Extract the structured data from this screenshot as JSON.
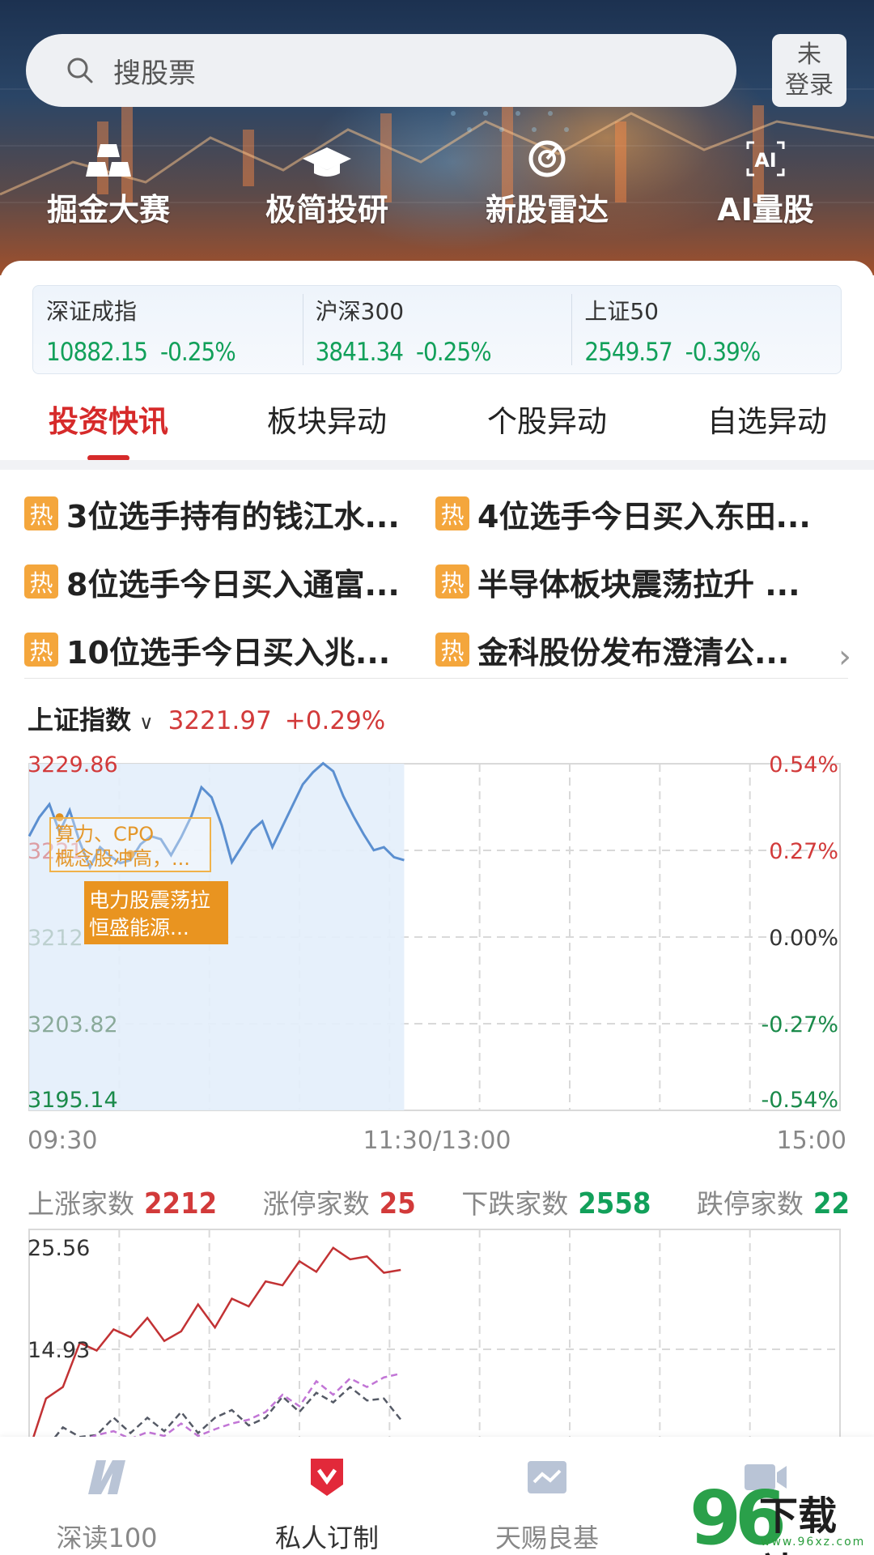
{
  "search": {
    "placeholder": "搜股票"
  },
  "login": {
    "line1": "未",
    "line2": "登录"
  },
  "quick_entries": [
    {
      "label": "掘金大赛",
      "icon": "gold-bars-icon"
    },
    {
      "label": "极简投研",
      "icon": "graduation-cap-icon"
    },
    {
      "label": "新股雷达",
      "icon": "radar-icon"
    },
    {
      "label": "AI量股",
      "icon": "ai-icon"
    }
  ],
  "indexes": [
    {
      "name": "深证成指",
      "value": "10882.15",
      "change": "-0.25%"
    },
    {
      "name": "沪深300",
      "value": "3841.34",
      "change": "-0.25%"
    },
    {
      "name": "上证50",
      "value": "2549.57",
      "change": "-0.39%"
    }
  ],
  "tabs": [
    {
      "label": "投资快讯",
      "active": true
    },
    {
      "label": "板块异动",
      "active": false
    },
    {
      "label": "个股异动",
      "active": false
    },
    {
      "label": "自选异动",
      "active": false
    }
  ],
  "news": {
    "badge": "热",
    "items": [
      "3位选手持有的钱江水...",
      "4位选手今日买入东田...",
      "8位选手今日买入通富...",
      "半导体板块震荡拉升 ...",
      "10位选手今日买入兆...",
      "金科股份发布澄清公..."
    ]
  },
  "chart_head": {
    "title": "上证指数",
    "price": "3221.97",
    "change": "+0.29%"
  },
  "chart_data": [
    {
      "type": "line",
      "title": "上证指数",
      "y_ticks_left": [
        "3229.86",
        "3221",
        "3212",
        "3203.82",
        "3195.14"
      ],
      "y_ticks_right": [
        "0.54%",
        "0.27%",
        "0.00%",
        "-0.27%",
        "-0.54%"
      ],
      "x_ticks": [
        "09:30",
        "11:30/13:00",
        "15:00"
      ],
      "ylim": [
        3195.14,
        3229.86
      ],
      "x_minutes": [
        0,
        3,
        6,
        9,
        12,
        15,
        18,
        21,
        24,
        27,
        30,
        33,
        36,
        39,
        42,
        45,
        48,
        51,
        54,
        57,
        60,
        63,
        66,
        69,
        72,
        75,
        78,
        81,
        84,
        87,
        90,
        93,
        96,
        99,
        102,
        105,
        108,
        111
      ],
      "values": [
        3222.6,
        3224.5,
        3225.8,
        3223.0,
        3225.2,
        3222.0,
        3219.5,
        3221.5,
        3220.6,
        3219.9,
        3220.2,
        3221.8,
        3222.6,
        3222.3,
        3220.7,
        3222.5,
        3224.6,
        3227.5,
        3226.5,
        3223.7,
        3220.0,
        3221.6,
        3223.2,
        3224.1,
        3221.5,
        3223.6,
        3225.7,
        3227.8,
        3229.0,
        3229.9,
        3229.1,
        3226.6,
        3224.6,
        3222.8,
        3221.2,
        3221.5,
        3220.5,
        3220.2
      ],
      "annotations": [
        "算力、CPO概念股冲高，...",
        "电力股震荡拉升 恒盛能源..."
      ]
    },
    {
      "type": "line",
      "y_ticks": [
        "25.56",
        "14.93"
      ],
      "x_minutes": [
        0,
        5,
        10,
        15,
        20,
        25,
        30,
        35,
        40,
        45,
        50,
        55,
        60,
        65,
        70,
        75,
        80,
        85,
        90,
        95,
        100,
        105,
        110
      ],
      "series": [
        {
          "values": [
            4.4,
            9.8,
            11.0,
            15.6,
            14.8,
            17.0,
            16.2,
            18.2,
            15.8,
            16.8,
            19.6,
            17.2,
            20.2,
            19.4,
            22.0,
            21.6,
            24.1,
            23.0,
            25.5,
            24.3,
            24.6,
            22.9,
            23.2
          ]
        },
        {
          "values": [
            4.2,
            4.6,
            6.8,
            5.8,
            6.0,
            7.8,
            6.2,
            7.8,
            6.4,
            8.4,
            6.2,
            7.8,
            8.6,
            7.0,
            7.8,
            10.0,
            8.4,
            10.4,
            9.4,
            11.0,
            9.6,
            9.8,
            7.6
          ]
        },
        {
          "values": [
            4.3,
            4.9,
            5.0,
            5.3,
            6.0,
            6.4,
            5.6,
            6.3,
            5.9,
            7.2,
            5.9,
            6.6,
            7.2,
            7.6,
            8.4,
            10.2,
            9.0,
            11.6,
            10.2,
            11.9,
            11.0,
            12.0,
            12.4
          ]
        }
      ]
    }
  ],
  "market_stats": [
    {
      "label": "上涨家数",
      "value": "2212",
      "dir": "up"
    },
    {
      "label": "涨停家数",
      "value": "25",
      "dir": "up"
    },
    {
      "label": "下跌家数",
      "value": "2558",
      "dir": "down"
    },
    {
      "label": "跌停家数",
      "value": "22",
      "dir": "down"
    }
  ],
  "bottom_nav": [
    {
      "label": "深读100",
      "icon": "deep-read-icon"
    },
    {
      "label": "私人订制",
      "icon": "custom-shield-icon",
      "active": true
    },
    {
      "label": "天赐良基",
      "icon": "fund-chart-icon"
    },
    {
      "label": "",
      "icon": "video-icon"
    }
  ],
  "watermark": {
    "text": "下载站",
    "url": "www.96xz.com",
    "num": "96"
  }
}
